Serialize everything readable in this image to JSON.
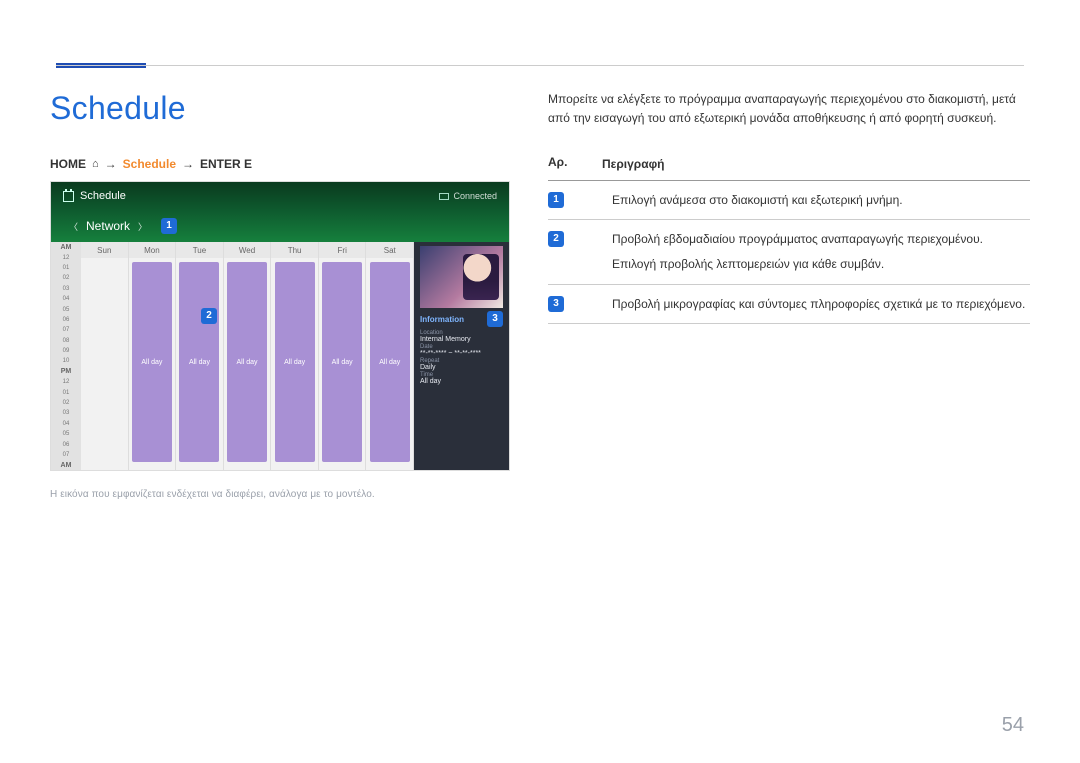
{
  "page_number": "54",
  "title": "Schedule",
  "breadcrumb": {
    "home": "HOME",
    "arrow": "→",
    "schedule": "Schedule",
    "arrow2": "→",
    "enter": "ENTER E"
  },
  "screenshot": {
    "title": "Schedule",
    "connected_label": "Connected",
    "network_label": "Network",
    "days": [
      "Sun",
      "Mon",
      "Tue",
      "Wed",
      "Thu",
      "Fri",
      "Sat"
    ],
    "time_labels": {
      "am": "AM",
      "pm": "PM",
      "am2": "AM"
    },
    "event_label": "All day",
    "info": {
      "title": "Information",
      "location_label": "Location",
      "location_value": "Internal Memory",
      "date_label": "Date",
      "date_value": "**-**-**** ~ **-**-****",
      "repeat_label": "Repeat",
      "repeat_value": "Daily",
      "time_label": "Time",
      "time_value": "All day"
    },
    "callouts": {
      "one": "1",
      "two": "2",
      "three": "3"
    }
  },
  "caption": "Η εικόνα που εμφανίζεται ενδέχεται να διαφέρει, ανάλογα με το μοντέλο.",
  "intro": "Μπορείτε να ελέγξετε το πρόγραμμα αναπαραγωγής περιεχομένου στο διακομιστή, μετά από την εισαγωγή του από εξωτερική μονάδα αποθήκευσης ή από φορητή συσκευή.",
  "table": {
    "head_num": "Αρ.",
    "head_desc": "Περιγραφή",
    "rows": [
      {
        "num": "1",
        "desc": [
          "Επιλογή ανάμεσα στο διακομιστή και εξωτερική μνήμη."
        ]
      },
      {
        "num": "2",
        "desc": [
          "Προβολή εβδομαδιαίου προγράμματος αναπαραγωγής περιεχομένου.",
          "Επιλογή προβολής λεπτομερειών για κάθε συμβάν."
        ]
      },
      {
        "num": "3",
        "desc": [
          "Προβολή μικρογραφίας και σύντομες πληροφορίες σχετικά με το περιεχόμενο."
        ]
      }
    ]
  }
}
